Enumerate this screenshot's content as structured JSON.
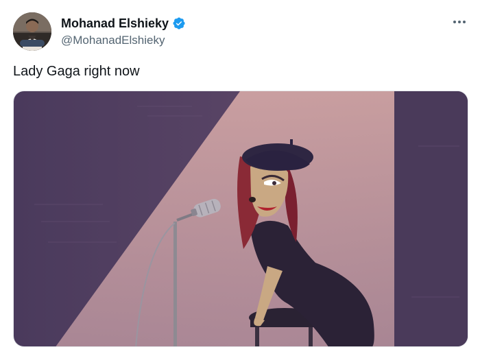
{
  "author": {
    "display_name": "Mohanad Elshieky",
    "handle": "@MohanadElshieky",
    "verified": true,
    "verified_color": "#1d9bf0"
  },
  "tweet": {
    "text": "Lady Gaga right now"
  },
  "media": {
    "type": "image",
    "icon": "cartoon-singer-image"
  },
  "menu": {
    "icon": "more-icon"
  }
}
